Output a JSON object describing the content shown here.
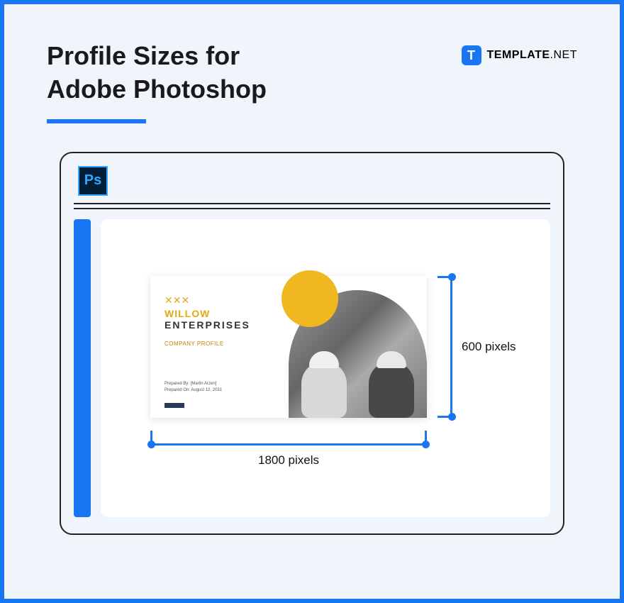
{
  "title_line1": "Profile Sizes for",
  "title_line2": "Adobe Photoshop",
  "brand": {
    "icon_letter": "T",
    "name": "TEMPLATE",
    "suffix": ".NET"
  },
  "app": {
    "icon_text": "Ps"
  },
  "card": {
    "logo_symbol": "✕✕✕",
    "brand_top": "WILLOW",
    "brand_bottom": "ENTERPRISES",
    "subtitle": "COMPANY PROFILE",
    "prepared_by_label": "Prepared By:",
    "prepared_by_value": "[Marlin Arzen]",
    "prepared_on_label": "Prepared On:",
    "prepared_on_value": "August 12, 2031"
  },
  "dimensions": {
    "width_label": "1800 pixels",
    "height_label": "600 pixels"
  }
}
